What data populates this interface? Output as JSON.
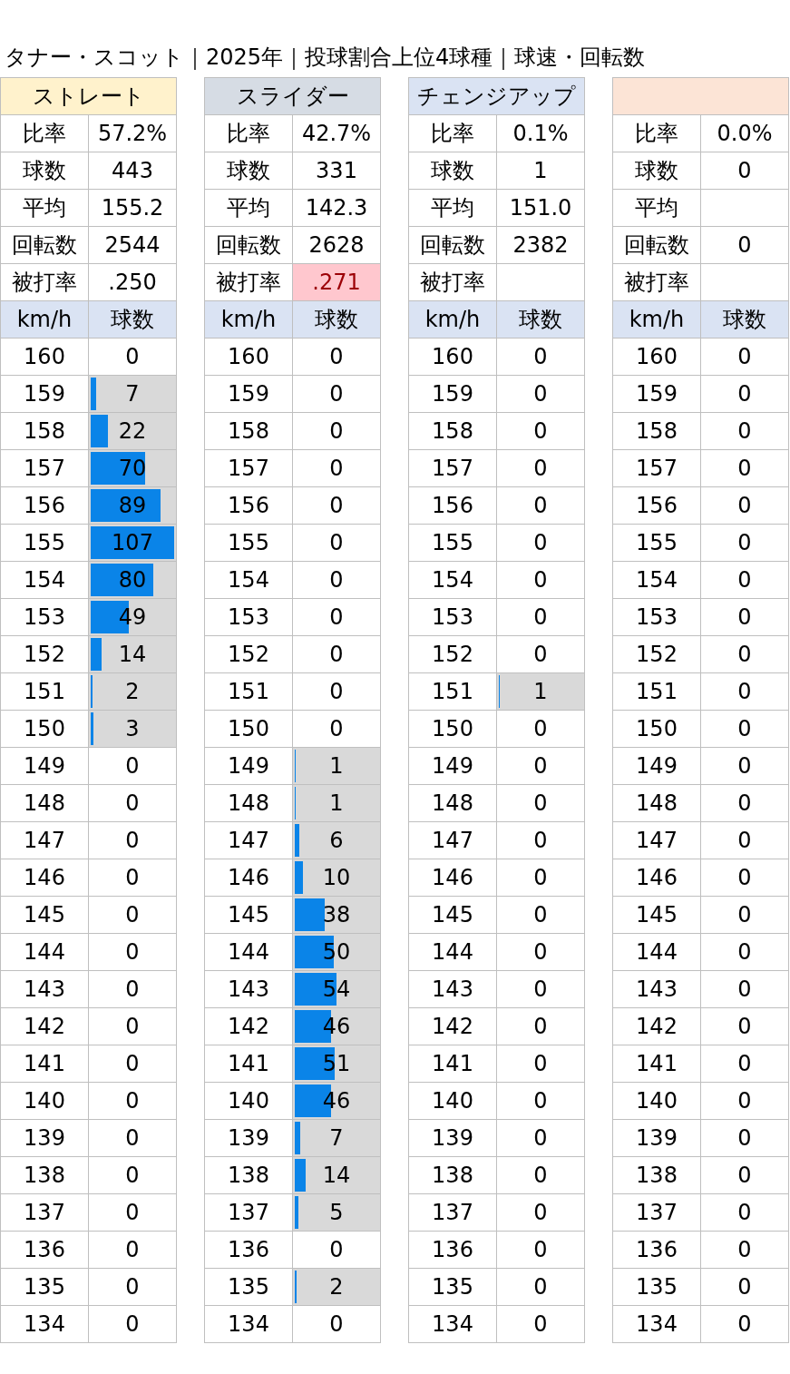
{
  "title": "タナー・スコット｜2025年｜投球割合上位4球種｜球速・回転数",
  "pitches": [
    {
      "name": "ストレート",
      "color": "#fff2cc",
      "stats": [
        {
          "label": "比率",
          "value": "57.2%",
          "highlight": false
        },
        {
          "label": "球数",
          "value": "443",
          "highlight": false
        },
        {
          "label": "平均",
          "value": "155.2",
          "highlight": false
        },
        {
          "label": "回転数",
          "value": "2544",
          "highlight": false
        },
        {
          "label": "被打率",
          "value": ".250",
          "highlight": false
        }
      ],
      "columns": [
        "km/h",
        "球数"
      ],
      "speeds": [
        {
          "kmh": "160",
          "count": "0"
        },
        {
          "kmh": "159",
          "count": "7",
          "level": 0.065
        },
        {
          "kmh": "158",
          "count": "22",
          "level": 0.206
        },
        {
          "kmh": "157",
          "count": "70",
          "level": 0.654
        },
        {
          "kmh": "156",
          "count": "89",
          "level": 0.832
        },
        {
          "kmh": "155",
          "count": "107",
          "level": 1
        },
        {
          "kmh": "154",
          "count": "80",
          "level": 0.748
        },
        {
          "kmh": "153",
          "count": "49",
          "level": 0.458
        },
        {
          "kmh": "152",
          "count": "14",
          "level": 0.131
        },
        {
          "kmh": "151",
          "count": "2",
          "level": 0.019
        },
        {
          "kmh": "150",
          "count": "3",
          "level": 0.028
        },
        {
          "kmh": "149",
          "count": "0"
        },
        {
          "kmh": "148",
          "count": "0"
        },
        {
          "kmh": "147",
          "count": "0"
        },
        {
          "kmh": "146",
          "count": "0"
        },
        {
          "kmh": "145",
          "count": "0"
        },
        {
          "kmh": "144",
          "count": "0"
        },
        {
          "kmh": "143",
          "count": "0"
        },
        {
          "kmh": "142",
          "count": "0"
        },
        {
          "kmh": "141",
          "count": "0"
        },
        {
          "kmh": "140",
          "count": "0"
        },
        {
          "kmh": "139",
          "count": "0"
        },
        {
          "kmh": "138",
          "count": "0"
        },
        {
          "kmh": "137",
          "count": "0"
        },
        {
          "kmh": "136",
          "count": "0"
        },
        {
          "kmh": "135",
          "count": "0"
        },
        {
          "kmh": "134",
          "count": "0"
        }
      ]
    },
    {
      "name": "スライダー",
      "color": "#d6dce4",
      "stats": [
        {
          "label": "比率",
          "value": "42.7%",
          "highlight": false
        },
        {
          "label": "球数",
          "value": "331",
          "highlight": false
        },
        {
          "label": "平均",
          "value": "142.3",
          "highlight": false
        },
        {
          "label": "回転数",
          "value": "2628",
          "highlight": false
        },
        {
          "label": "被打率",
          "value": ".271",
          "highlight": true
        }
      ],
      "columns": [
        "km/h",
        "球数"
      ],
      "speeds": [
        {
          "kmh": "160",
          "count": "0"
        },
        {
          "kmh": "159",
          "count": "0"
        },
        {
          "kmh": "158",
          "count": "0"
        },
        {
          "kmh": "157",
          "count": "0"
        },
        {
          "kmh": "156",
          "count": "0"
        },
        {
          "kmh": "155",
          "count": "0"
        },
        {
          "kmh": "154",
          "count": "0"
        },
        {
          "kmh": "153",
          "count": "0"
        },
        {
          "kmh": "152",
          "count": "0"
        },
        {
          "kmh": "151",
          "count": "0"
        },
        {
          "kmh": "150",
          "count": "0"
        },
        {
          "kmh": "149",
          "count": "1",
          "level": 0.009
        },
        {
          "kmh": "148",
          "count": "1",
          "level": 0.009
        },
        {
          "kmh": "147",
          "count": "6",
          "level": 0.056
        },
        {
          "kmh": "146",
          "count": "10",
          "level": 0.093
        },
        {
          "kmh": "145",
          "count": "38",
          "level": 0.355
        },
        {
          "kmh": "144",
          "count": "50",
          "level": 0.467
        },
        {
          "kmh": "143",
          "count": "54",
          "level": 0.505
        },
        {
          "kmh": "142",
          "count": "46",
          "level": 0.43
        },
        {
          "kmh": "141",
          "count": "51",
          "level": 0.477
        },
        {
          "kmh": "140",
          "count": "46",
          "level": 0.43
        },
        {
          "kmh": "139",
          "count": "7",
          "level": 0.065
        },
        {
          "kmh": "138",
          "count": "14",
          "level": 0.131
        },
        {
          "kmh": "137",
          "count": "5",
          "level": 0.047
        },
        {
          "kmh": "136",
          "count": "0"
        },
        {
          "kmh": "135",
          "count": "2",
          "level": 0.019
        },
        {
          "kmh": "134",
          "count": "0"
        }
      ]
    },
    {
      "name": "チェンジアップ",
      "color": "#dae3f3",
      "stats": [
        {
          "label": "比率",
          "value": "0.1%",
          "highlight": false
        },
        {
          "label": "球数",
          "value": "1",
          "highlight": false
        },
        {
          "label": "平均",
          "value": "151.0",
          "highlight": false
        },
        {
          "label": "回転数",
          "value": "2382",
          "highlight": false
        },
        {
          "label": "被打率",
          "highlight": false
        }
      ],
      "columns": [
        "km/h",
        "球数"
      ],
      "speeds": [
        {
          "kmh": "160",
          "count": "0"
        },
        {
          "kmh": "159",
          "count": "0"
        },
        {
          "kmh": "158",
          "count": "0"
        },
        {
          "kmh": "157",
          "count": "0"
        },
        {
          "kmh": "156",
          "count": "0"
        },
        {
          "kmh": "155",
          "count": "0"
        },
        {
          "kmh": "154",
          "count": "0"
        },
        {
          "kmh": "153",
          "count": "0"
        },
        {
          "kmh": "152",
          "count": "0"
        },
        {
          "kmh": "151",
          "count": "1",
          "level": 0.009
        },
        {
          "kmh": "150",
          "count": "0"
        },
        {
          "kmh": "149",
          "count": "0"
        },
        {
          "kmh": "148",
          "count": "0"
        },
        {
          "kmh": "147",
          "count": "0"
        },
        {
          "kmh": "146",
          "count": "0"
        },
        {
          "kmh": "145",
          "count": "0"
        },
        {
          "kmh": "144",
          "count": "0"
        },
        {
          "kmh": "143",
          "count": "0"
        },
        {
          "kmh": "142",
          "count": "0"
        },
        {
          "kmh": "141",
          "count": "0"
        },
        {
          "kmh": "140",
          "count": "0"
        },
        {
          "kmh": "139",
          "count": "0"
        },
        {
          "kmh": "138",
          "count": "0"
        },
        {
          "kmh": "137",
          "count": "0"
        },
        {
          "kmh": "136",
          "count": "0"
        },
        {
          "kmh": "135",
          "count": "0"
        },
        {
          "kmh": "134",
          "count": "0"
        }
      ]
    },
    {
      "color": "#fce4d6",
      "stats": [
        {
          "label": "比率",
          "value": "0.0%",
          "highlight": false
        },
        {
          "label": "球数",
          "value": "0",
          "highlight": false
        },
        {
          "label": "平均",
          "highlight": false
        },
        {
          "label": "回転数",
          "value": "0",
          "highlight": false
        },
        {
          "label": "被打率",
          "highlight": false
        }
      ],
      "columns": [
        "km/h",
        "球数"
      ],
      "speeds": [
        {
          "kmh": "160",
          "count": "0"
        },
        {
          "kmh": "159",
          "count": "0"
        },
        {
          "kmh": "158",
          "count": "0"
        },
        {
          "kmh": "157",
          "count": "0"
        },
        {
          "kmh": "156",
          "count": "0"
        },
        {
          "kmh": "155",
          "count": "0"
        },
        {
          "kmh": "154",
          "count": "0"
        },
        {
          "kmh": "153",
          "count": "0"
        },
        {
          "kmh": "152",
          "count": "0"
        },
        {
          "kmh": "151",
          "count": "0"
        },
        {
          "kmh": "150",
          "count": "0"
        },
        {
          "kmh": "149",
          "count": "0"
        },
        {
          "kmh": "148",
          "count": "0"
        },
        {
          "kmh": "147",
          "count": "0"
        },
        {
          "kmh": "146",
          "count": "0"
        },
        {
          "kmh": "145",
          "count": "0"
        },
        {
          "kmh": "144",
          "count": "0"
        },
        {
          "kmh": "143",
          "count": "0"
        },
        {
          "kmh": "142",
          "count": "0"
        },
        {
          "kmh": "141",
          "count": "0"
        },
        {
          "kmh": "140",
          "count": "0"
        },
        {
          "kmh": "139",
          "count": "0"
        },
        {
          "kmh": "138",
          "count": "0"
        },
        {
          "kmh": "137",
          "count": "0"
        },
        {
          "kmh": "136",
          "count": "0"
        },
        {
          "kmh": "135",
          "count": "0"
        },
        {
          "kmh": "134",
          "count": "0"
        }
      ]
    }
  ]
}
